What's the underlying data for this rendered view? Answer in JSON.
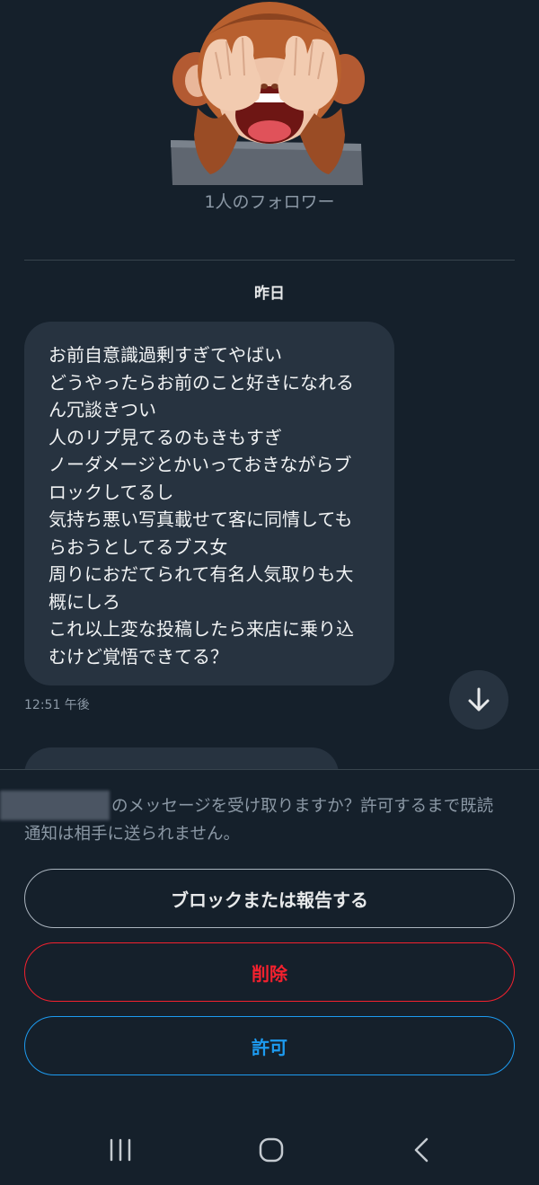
{
  "profile": {
    "followers_text": "1人のフォロワー",
    "avatar_icon": "see-no-evil-monkey-memoji"
  },
  "conversation": {
    "date_label": "昨日",
    "message": {
      "lines": [
        "お前自意識過剰すぎてやばい",
        "どうやったらお前のこと好きになれる",
        "ん冗談きつい",
        "人のリプ見てるのもきもすぎ",
        "ノーダメージとかいっておきながらブ",
        "ロックしてるし",
        "気持ち悪い写真載せて客に同情しても",
        "らおうとしてるブス女",
        "周りにおだてられて有名人気取りも大",
        "概にしろ",
        "これ以上変な投稿したら来店に乗り込",
        "むけど覚悟できてる？"
      ],
      "timestamp": "12:51 午後"
    },
    "scroll_icon": "arrow-down-icon"
  },
  "request_panel": {
    "prompt_line1": "のメッセージを受け取りますか？許可するまで既読",
    "prompt_line2": "通知は相手に送られません。",
    "block_label": "ブロックまたは報告する",
    "delete_label": "削除",
    "allow_label": "許可",
    "colors": {
      "danger": "#f4212e",
      "accent": "#1d9bf0"
    }
  },
  "nav": {
    "recent_icon": "recent-apps-icon",
    "home_icon": "home-icon",
    "back_icon": "back-icon"
  }
}
